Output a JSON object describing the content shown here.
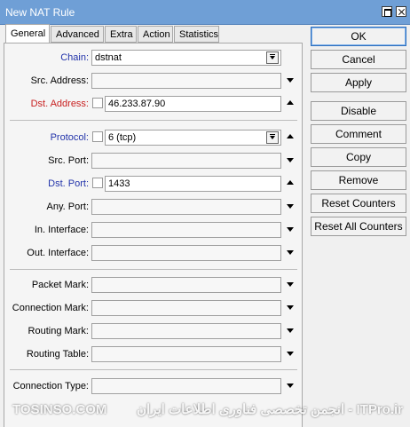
{
  "window": {
    "title": "New NAT Rule"
  },
  "tabs": [
    "General",
    "Advanced",
    "Extra",
    "Action",
    "Statistics"
  ],
  "fields": {
    "chain": {
      "label": "Chain:",
      "value": "dstnat"
    },
    "src_address": {
      "label": "Src. Address:",
      "value": ""
    },
    "dst_address": {
      "label": "Dst. Address:",
      "value": "46.233.87.90"
    },
    "protocol": {
      "label": "Protocol:",
      "value": "6 (tcp)"
    },
    "src_port": {
      "label": "Src. Port:",
      "value": ""
    },
    "dst_port": {
      "label": "Dst. Port:",
      "value": "1433"
    },
    "any_port": {
      "label": "Any. Port:",
      "value": ""
    },
    "in_interface": {
      "label": "In. Interface:",
      "value": ""
    },
    "out_interface": {
      "label": "Out. Interface:",
      "value": ""
    },
    "packet_mark": {
      "label": "Packet Mark:",
      "value": ""
    },
    "connection_mark": {
      "label": "Connection Mark:",
      "value": ""
    },
    "routing_mark": {
      "label": "Routing Mark:",
      "value": ""
    },
    "routing_table": {
      "label": "Routing Table:",
      "value": ""
    },
    "connection_type": {
      "label": "Connection Type:",
      "value": ""
    }
  },
  "buttons": {
    "ok": "OK",
    "cancel": "Cancel",
    "apply": "Apply",
    "disable": "Disable",
    "comment": "Comment",
    "copy": "Copy",
    "remove": "Remove",
    "reset_counters": "Reset Counters",
    "reset_all_counters": "Reset All Counters"
  },
  "watermark": {
    "left": "TOSINSO.COM",
    "right": "ITPro.ir - انجمن تخصصی فناوری اطلاعات ایران"
  },
  "colors": {
    "titlebar": "#6f9fd6",
    "label_blue": "#2233aa",
    "label_red": "#c82020",
    "ok_border": "#2d6fbf"
  }
}
